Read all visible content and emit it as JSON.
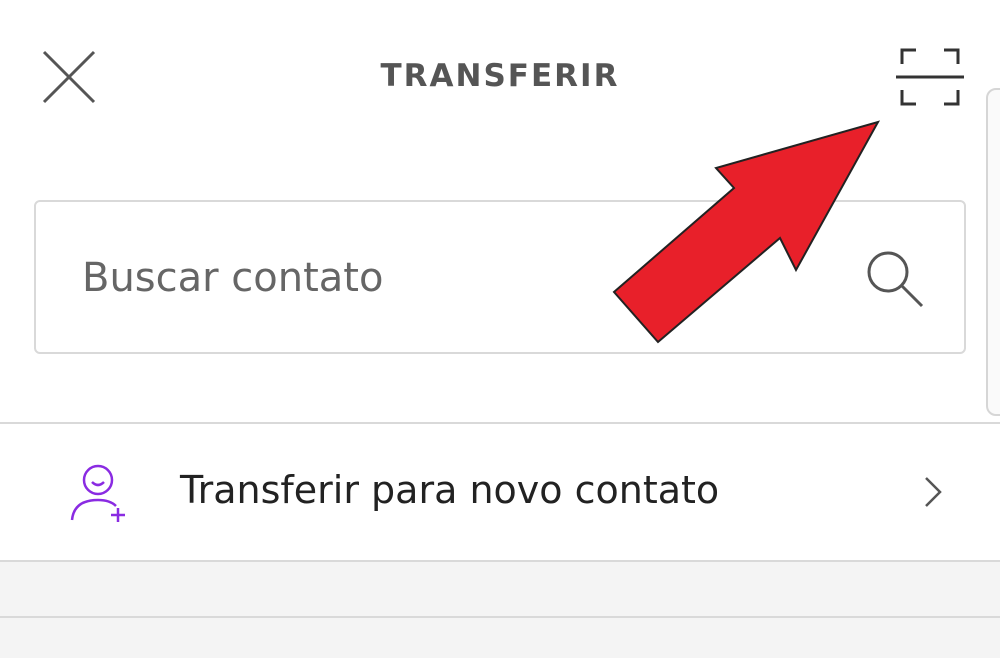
{
  "header": {
    "title": "TRANSFERIR",
    "close_icon": "close-icon",
    "scan_icon": "qr-scan-icon"
  },
  "search": {
    "placeholder": "Buscar contato",
    "icon": "search-icon"
  },
  "new_contact": {
    "label": "Transferir para novo contato",
    "icon": "person-add-icon",
    "chevron": "chevron-right-icon",
    "icon_color": "#8a2be2"
  },
  "annotation": {
    "arrow_color": "#e8202a"
  }
}
